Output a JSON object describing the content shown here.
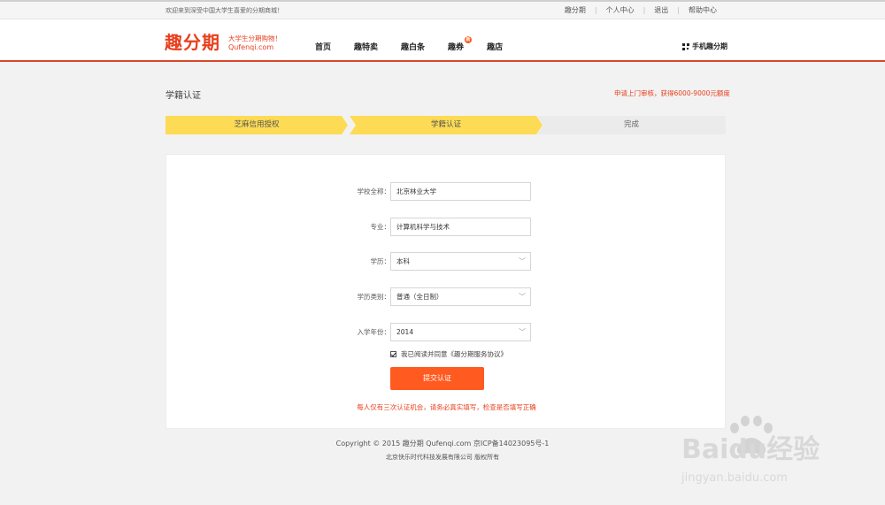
{
  "topbar": {
    "welcome": "欢迎来到深受中国大学生喜爱的分期商城！",
    "links": [
      "趣分期",
      "个人中心",
      "退出",
      "帮助中心"
    ]
  },
  "header": {
    "logo": "趣分期",
    "slogan": "大学生分期购物！",
    "domain": "Qufenqi.com",
    "nav": [
      "首页",
      "趣特卖",
      "趣白条",
      "趣券",
      "趣店"
    ],
    "nav_badge": "新",
    "mobile": "手机趣分期"
  },
  "page": {
    "title": "学籍认证",
    "promo": "申请上门审核，获得6000-9000元额度"
  },
  "steps": [
    "芝麻信用授权",
    "学籍认证",
    "完成"
  ],
  "form": {
    "school_label": "学校全称：",
    "school_value": "北京林业大学",
    "major_label": "专业：",
    "major_value": "计算机科学与技术",
    "degree_label": "学历：",
    "degree_value": "本科",
    "degree_type_label": "学历类别：",
    "degree_type_value": "普通（全日制）",
    "year_label": "入学年份：",
    "year_value": "2014",
    "agree_text": "我已阅读并同意《趣分期服务协议》",
    "submit_label": "提交认证",
    "notice": "每人仅有三次认证机会，请务必真实填写，检查是否填写正确"
  },
  "footer": {
    "line1": "Copyright © 2015 趣分期 Qufenqi.com 京ICP备14023095号-1",
    "line2": "北京快乐时代科技发展有限公司 版权所有"
  },
  "watermark": {
    "brand": "Baidu经验",
    "url": "jingyan.baidu.com"
  }
}
